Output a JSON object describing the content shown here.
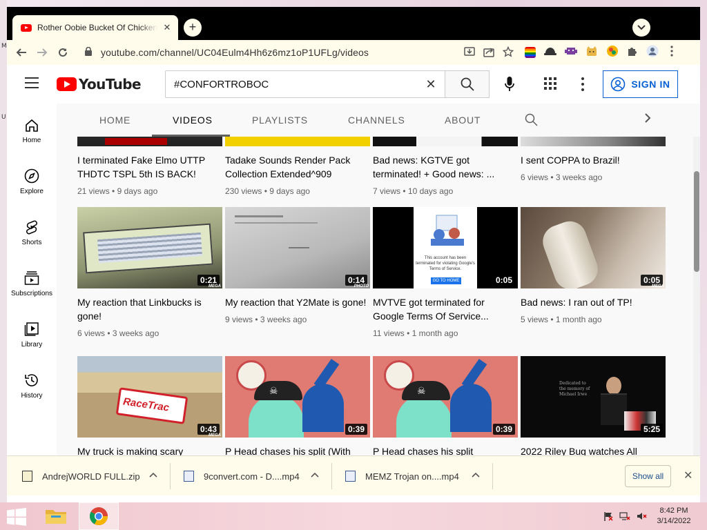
{
  "desktop": {
    "left_icon_labels": [
      "Mi",
      "U"
    ]
  },
  "browser": {
    "tab_title": "Rother Oobie Bucket Of Chicken",
    "url": "youtube.com/channel/UC04Eulm4Hh6z6mz1oP1UFLg/videos",
    "extension_icons": [
      "ext-pride-flag-icon",
      "ext-hat-icon",
      "ext-alien-icon",
      "ext-cat-icon",
      "ext-color-icon",
      "puzzle-icon",
      "profile-icon"
    ]
  },
  "youtube": {
    "logo_text": "YouTube",
    "search_value": "#CONFORTROBOC",
    "signin_label": "SIGN IN",
    "sidebar": [
      {
        "label": "Home",
        "icon": "home-icon"
      },
      {
        "label": "Explore",
        "icon": "compass-icon"
      },
      {
        "label": "Shorts",
        "icon": "shorts-icon"
      },
      {
        "label": "Subscriptions",
        "icon": "subscriptions-icon"
      },
      {
        "label": "Library",
        "icon": "library-icon"
      },
      {
        "label": "History",
        "icon": "history-icon"
      }
    ],
    "channel_tabs": [
      "HOME",
      "VIDEOS",
      "PLAYLISTS",
      "CHANNELS",
      "ABOUT"
    ],
    "active_tab": "VIDEOS",
    "videos": [
      {
        "title": "I terminated Fake Elmo UTTP THDTC TSPL 5th IS BACK!",
        "views": "21 views",
        "age": "9 days ago",
        "duration": ""
      },
      {
        "title": "Tadake Sounds Render Pack Collection Extended^909",
        "views": "230 views",
        "age": "9 days ago",
        "duration": ""
      },
      {
        "title": "Bad news: KGTVE got terminated! + Good news: ...",
        "views": "7 views",
        "age": "10 days ago",
        "duration": ""
      },
      {
        "title": "I sent COPPA to Brazil!",
        "views": "6 views",
        "age": "3 weeks ago",
        "duration": ""
      },
      {
        "title": "My reaction that Linkbucks is gone!",
        "views": "6 views",
        "age": "3 weeks ago",
        "duration": "0:21"
      },
      {
        "title": "My reaction that Y2Mate is gone!",
        "views": "9 views",
        "age": "3 weeks ago",
        "duration": "0:14"
      },
      {
        "title": "MVTVE got terminated for Google Terms Of Service...",
        "views": "11 views",
        "age": "1 month ago",
        "duration": "0:05"
      },
      {
        "title": "Bad news: I ran out of TP!",
        "views": "5 views",
        "age": "1 month ago",
        "duration": "0:05"
      },
      {
        "title": "My truck is making scary",
        "views": "",
        "age": "",
        "duration": "0:43"
      },
      {
        "title": "P Head chases his split (With",
        "views": "",
        "age": "",
        "duration": "0:39"
      },
      {
        "title": "P Head chases his split",
        "views": "",
        "age": "",
        "duration": "0:39"
      },
      {
        "title": "2022 Riley Bug watches All",
        "views": "",
        "age": "",
        "duration": "5:25"
      }
    ],
    "thumb_text": {
      "terminated_msg": "This account has been terminated for violating Google's Terms of Service.",
      "go_home": "GO TO HOME",
      "racetrac": "RaceTrac",
      "dedication": "Dedicated to the memory of Michael Irwe"
    },
    "watermarks": [
      "MEGA",
      "PHOTO"
    ]
  },
  "downloads": {
    "items": [
      "AndrejWORLD FULL.zip",
      "9convert.com - D....mp4",
      "MEMZ Trojan on....mp4"
    ],
    "show_all_label": "Show all"
  },
  "taskbar": {
    "time": "8:42 PM",
    "date": "3/14/2022"
  }
}
